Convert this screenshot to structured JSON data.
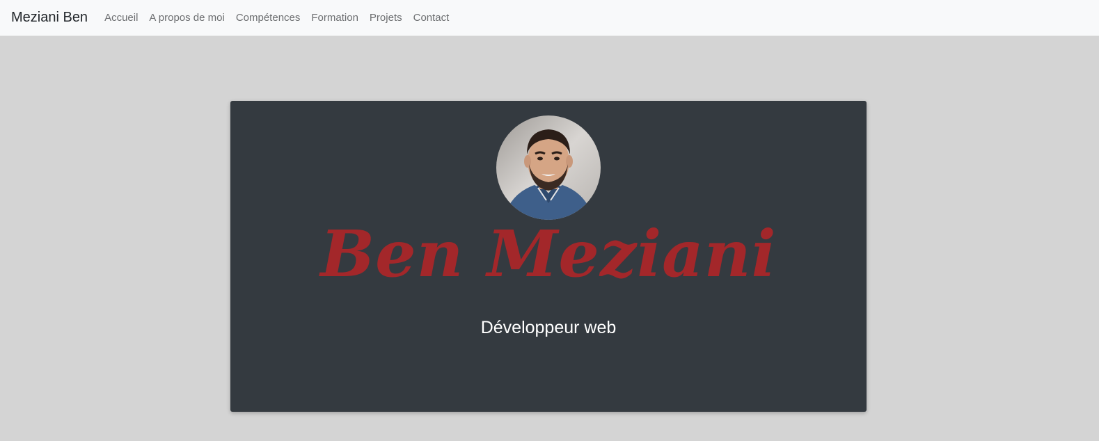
{
  "navbar": {
    "brand": "Meziani Ben",
    "links": [
      {
        "label": "Accueil"
      },
      {
        "label": "A propos de moi"
      },
      {
        "label": "Compétences"
      },
      {
        "label": "Formation"
      },
      {
        "label": "Projets"
      },
      {
        "label": "Contact"
      }
    ]
  },
  "hero": {
    "avatar_icon": "profile-photo",
    "name": "Ben Meziani",
    "subtitle": "Développeur web"
  },
  "colors": {
    "page_background": "#d4d4d4",
    "navbar_background": "#f8f9fa",
    "card_background": "#343a40",
    "name_color": "#a3272a",
    "subtitle_color": "#ffffff"
  }
}
